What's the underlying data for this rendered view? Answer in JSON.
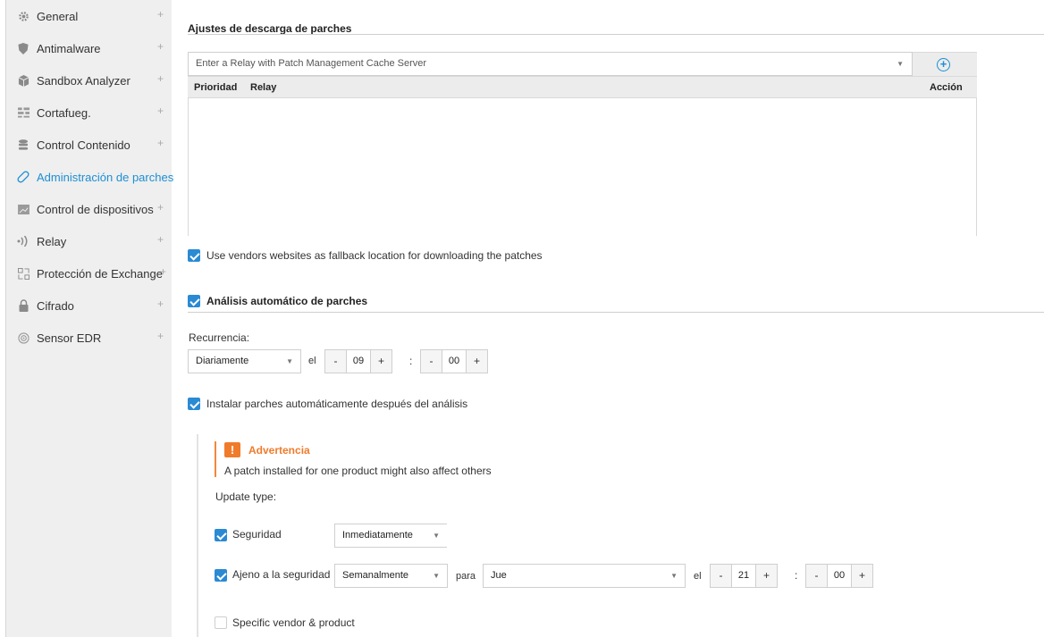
{
  "sidebar": {
    "items": [
      {
        "label": "General",
        "icon": "gear-icon",
        "plus": "+",
        "active": false
      },
      {
        "label": "Antimalware",
        "icon": "shield-icon",
        "plus": "+",
        "active": false
      },
      {
        "label": "Sandbox Analyzer",
        "icon": "cube-icon",
        "plus": "+",
        "active": false
      },
      {
        "label": "Cortafueg.",
        "icon": "firewall-icon",
        "plus": "+",
        "active": false
      },
      {
        "label": "Control Contenido",
        "icon": "database-icon",
        "plus": "+",
        "active": false
      },
      {
        "label": "Administración de parches",
        "icon": "patch-icon",
        "plus": "",
        "active": true
      },
      {
        "label": "Control de dispositivos",
        "icon": "device-icon",
        "plus": "+",
        "active": false
      },
      {
        "label": "Relay",
        "icon": "relay-icon",
        "plus": "+",
        "active": false
      },
      {
        "label": "Protección de Exchange",
        "icon": "exchange-icon",
        "plus": "+",
        "active": false
      },
      {
        "label": "Cifrado",
        "icon": "lock-icon",
        "plus": "+",
        "active": false
      },
      {
        "label": "Sensor EDR",
        "icon": "sensor-icon",
        "plus": "+",
        "active": false
      }
    ]
  },
  "download": {
    "title": "Ajustes de descarga de parches",
    "relay_placeholder": "Enter a Relay with Patch Management Cache Server",
    "col_priority": "Prioridad",
    "col_relay": "Relay",
    "col_action": "Acción",
    "fallback_label": "Use vendors websites as fallback location for downloading the patches",
    "fallback_checked": true
  },
  "scan": {
    "title": "Análisis automático de parches",
    "checked": true,
    "recurrence_label": "Recurrencia:",
    "recurrence_value": "Diariamente",
    "el": "el",
    "hour": "09",
    "minute": "00",
    "minus": "-",
    "plus": "+",
    "colon": ":"
  },
  "install": {
    "label": "Instalar parches automáticamente después del análisis",
    "checked": true,
    "warning_title": "Advertencia",
    "warning_text": "A patch installed for one product might also affect others",
    "warning_glyph": "!",
    "update_type_label": "Update type:",
    "security_label": "Seguridad",
    "security_value": "Inmediatamente",
    "nonsecurity_label": "Ajeno a la seguridad",
    "nonsecurity_value": "Semanalmente",
    "para": "para",
    "day_value": "Jue",
    "el": "el",
    "hour": "21",
    "minute": "00",
    "specific_label": "Specific vendor & product",
    "specific_checked": false
  },
  "colors": {
    "accent": "#1d8fd3",
    "warning": "#f07b2b",
    "checkbox": "#2a8ad3"
  }
}
